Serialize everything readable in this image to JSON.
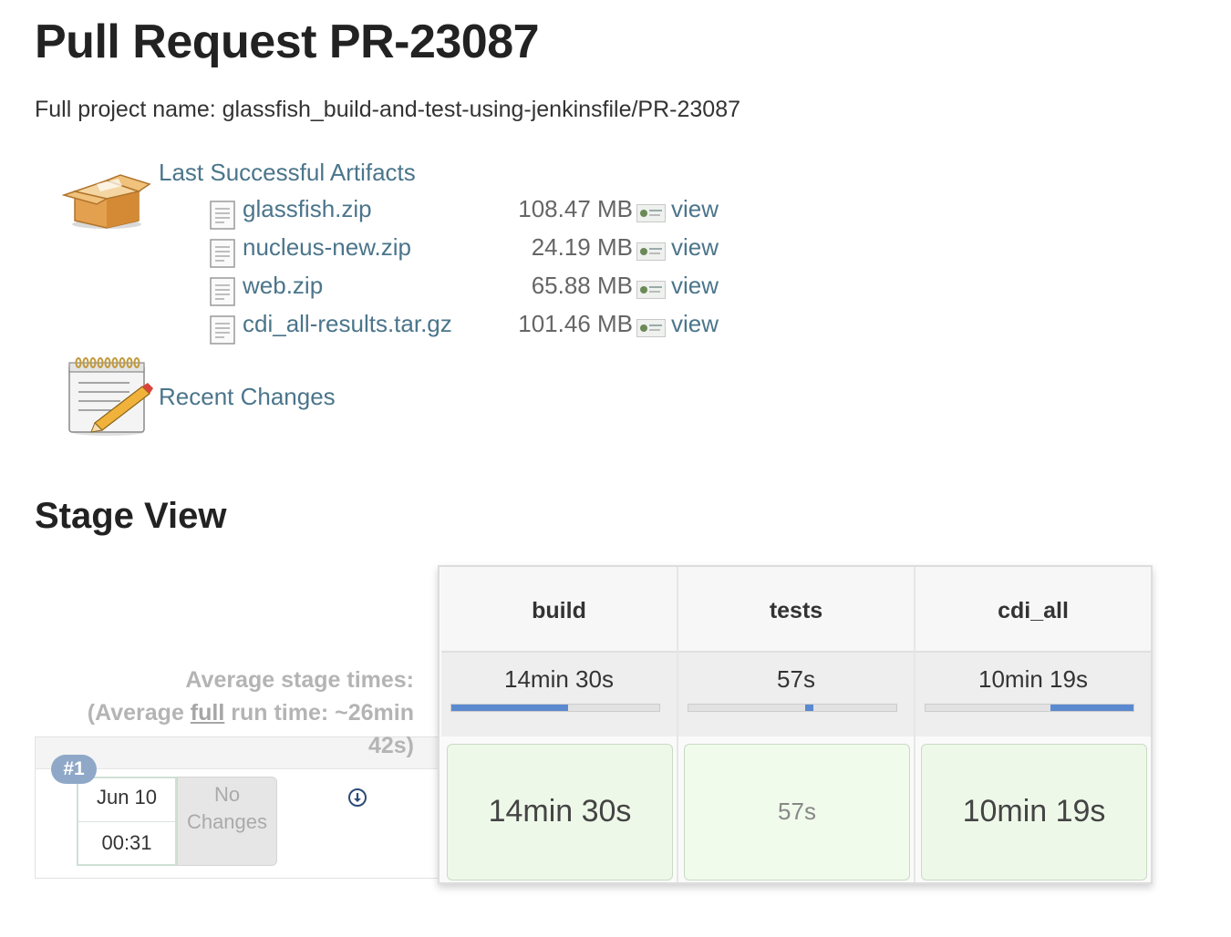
{
  "page": {
    "title": "Pull Request PR-23087",
    "full_project_name": "Full project name: glassfish_build-and-test-using-jenkinsfile/PR-23087"
  },
  "artifacts": {
    "section_label": "Last Successful Artifacts",
    "icon": "package-box-icon",
    "items": [
      {
        "name": "glassfish.zip",
        "size": "108.47 MB",
        "view_label": "view"
      },
      {
        "name": "nucleus-new.zip",
        "size": "24.19 MB",
        "view_label": "view"
      },
      {
        "name": "web.zip",
        "size": "65.88 MB",
        "view_label": "view"
      },
      {
        "name": "cdi_all-results.tar.gz",
        "size": "101.46 MB",
        "view_label": "view"
      }
    ]
  },
  "recent_changes": {
    "label": "Recent Changes",
    "icon": "notepad-pencil-icon"
  },
  "stage_view": {
    "heading": "Stage View",
    "average_label_line1": "Average stage times:",
    "average_label_prefix": "(Average ",
    "average_label_full": "full",
    "average_label_suffix": " run time: ~26min 42s)",
    "stages": [
      {
        "name": "build",
        "avg": "14min 30s",
        "bar_start": 0.0,
        "bar_end": 0.56,
        "cell": "14min 30s"
      },
      {
        "name": "tests",
        "avg": "57s",
        "bar_start": 0.56,
        "bar_end": 0.6,
        "cell": "57s"
      },
      {
        "name": "cdi_all",
        "avg": "10min 19s",
        "bar_start": 0.6,
        "bar_end": 1.0,
        "cell": "10min 19s"
      }
    ],
    "builds": [
      {
        "badge": "#1",
        "date": "Jun 10",
        "time": "00:31",
        "changes": "No Changes"
      }
    ],
    "bar_color": "#5b89d0",
    "cell_color": "#eef8e9"
  }
}
